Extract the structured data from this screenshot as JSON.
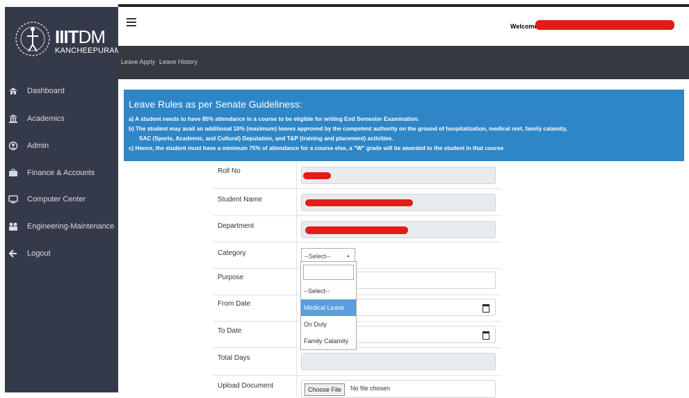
{
  "brand": {
    "name_bold": "IIIT",
    "name_light": "DM",
    "subtitle": "KANCHEEPURAM"
  },
  "sidebar": {
    "items": [
      {
        "label": "Dashboard",
        "icon": "home-icon"
      },
      {
        "label": "Academics",
        "icon": "bank-icon"
      },
      {
        "label": "Admin",
        "icon": "user-circle-icon"
      },
      {
        "label": "Finance & Accounts",
        "icon": "briefcase-icon"
      },
      {
        "label": "Computer Center",
        "icon": "monitor-icon"
      },
      {
        "label": "Engineering-Maintenance",
        "icon": "tools-icon"
      },
      {
        "label": "Logout",
        "icon": "arrow-left-icon"
      }
    ]
  },
  "header": {
    "welcome": "Welcome"
  },
  "subnav": {
    "leave_apply": "Leave Apply",
    "leave_history": "Leave History"
  },
  "rules": {
    "title": "Leave Rules as per Senate Guideliness:",
    "lines": [
      "a) A student needs to have 85% attendance in a course to be eligible for writing End Semester Examination.",
      "b) The student may avail an additional 10% (maximum) leaves approved by the competent authority on the ground of hospitalization, medical rest, family calamity,",
      "SAC (Sports, Academic, and Cultural) Deputation, and T&P (training and placement) activities.",
      "c) Hence, the student must have a minimum 75% of attendance for a course else, a \"W\" grade will be awarded to the student in that course"
    ]
  },
  "form": {
    "roll_no": "Roll No",
    "student_name": "Student Name",
    "department": "Department",
    "category": "Category",
    "category_value": "--Select--",
    "purpose": "Purpose",
    "from_date": "From Date",
    "to_date": "To Date",
    "total_days": "Total Days",
    "upload_document": "Upload Document",
    "choose_file": "Choose File",
    "no_file": "No file chosen"
  },
  "dropdown": {
    "options": [
      "--Select--",
      "Medical Leave",
      "On Duty",
      "Family Calamity"
    ],
    "highlighted": "Medical Leave"
  },
  "colors": {
    "sidebar": "#343a4a",
    "rules_bg": "#2e86c6",
    "highlight": "#5b9ddd",
    "redaction": "#e41b17"
  }
}
